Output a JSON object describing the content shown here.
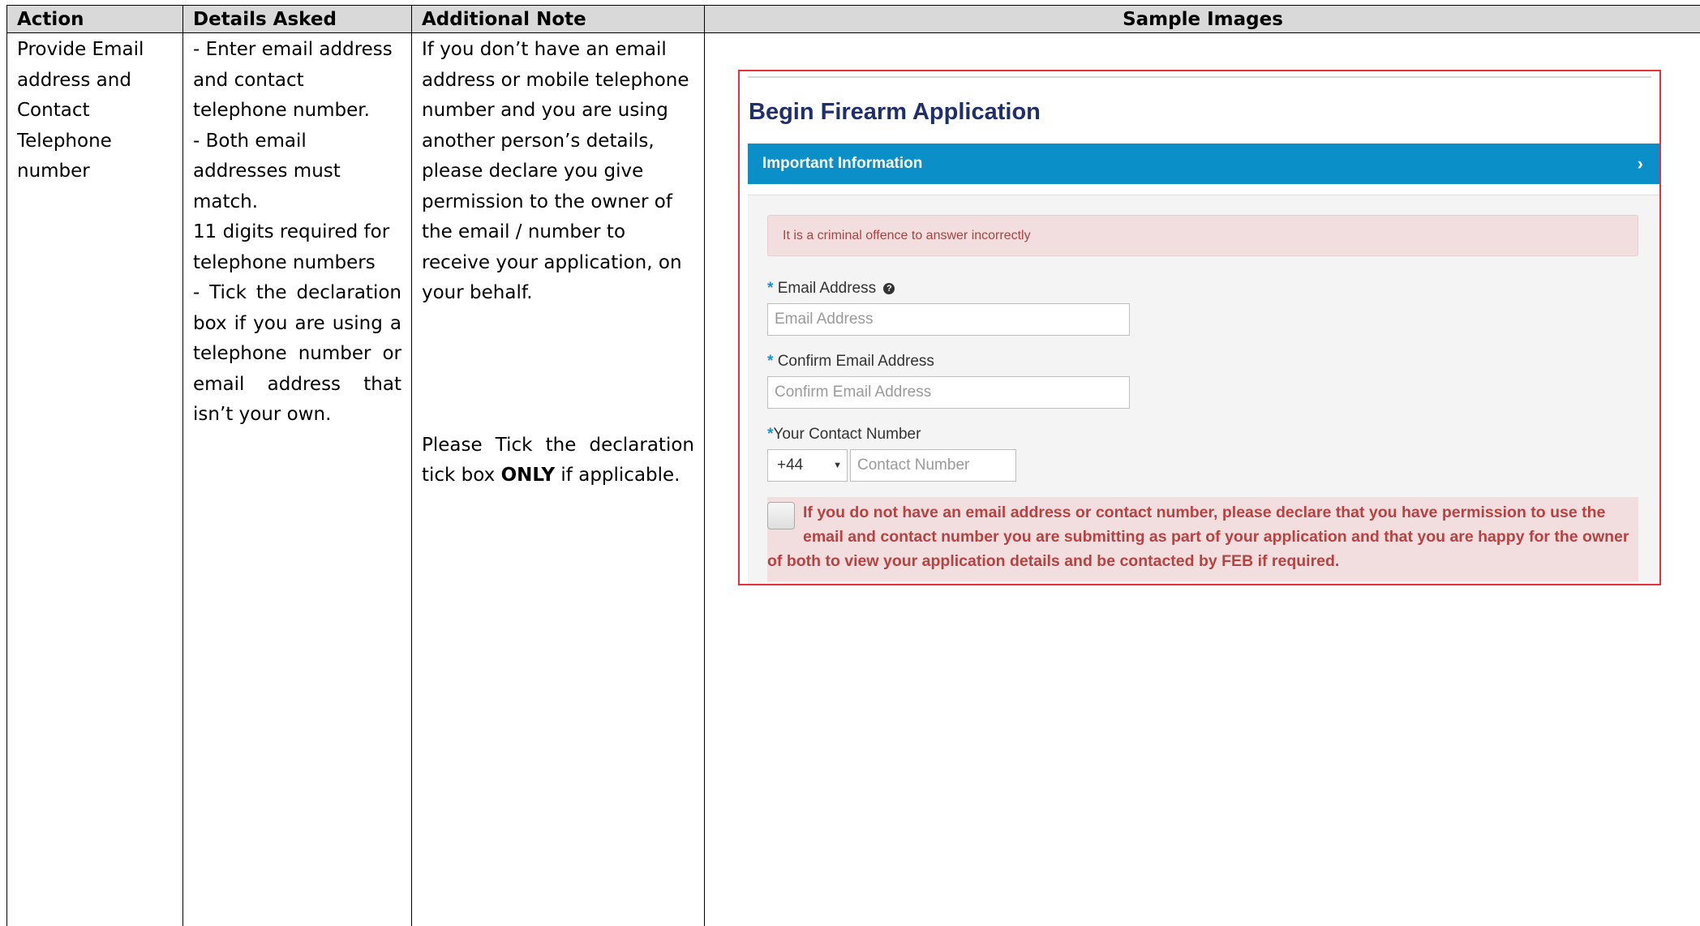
{
  "table": {
    "headers": [
      "Action",
      "Details Asked",
      "Additional Note",
      "Sample Images"
    ],
    "action": "Provide Email address and Contact Telephone number",
    "details": [
      "- Enter email address and contact telephone number.",
      "- Both email addresses must match.",
      "11 digits required for telephone numbers",
      "- Tick the declaration box if you are using a telephone number or email address that isn’t your own."
    ],
    "note1": "If you don’t have an email address or mobile telephone number and you are using another person’s details, please declare you give permission to the owner of the email / number to receive your application, on your behalf.",
    "note2": {
      "before": "Please Tick the declaration tick box ",
      "bold": "ONLY",
      "after": " if applicable."
    }
  },
  "sample": {
    "title": "Begin Firearm Application",
    "banner": "Important Information",
    "banner_chevron": "›",
    "alert": "It is a criminal offence to answer incorrectly",
    "required_star": "*",
    "email_label": "Email Address",
    "email_placeholder": "Email Address",
    "confirm_label": "Confirm Email Address",
    "confirm_placeholder": "Confirm Email Address",
    "contact_label": "Your Contact Number",
    "country_code": "+44",
    "contact_placeholder": "Contact Number",
    "declaration": "If you do not have an email address or contact number, please declare that you have permission to use the email and contact number you are submitting as part of your application and that you are happy for the owner of both to view your application details and be contacted by FEB if required.",
    "colors": {
      "frame_border": "#e8313a",
      "title": "#1f2f6b",
      "banner": "#0a8fc8",
      "alert_bg": "#f2dede",
      "alert_text": "#a94442",
      "star": "#1d8fcb"
    }
  }
}
